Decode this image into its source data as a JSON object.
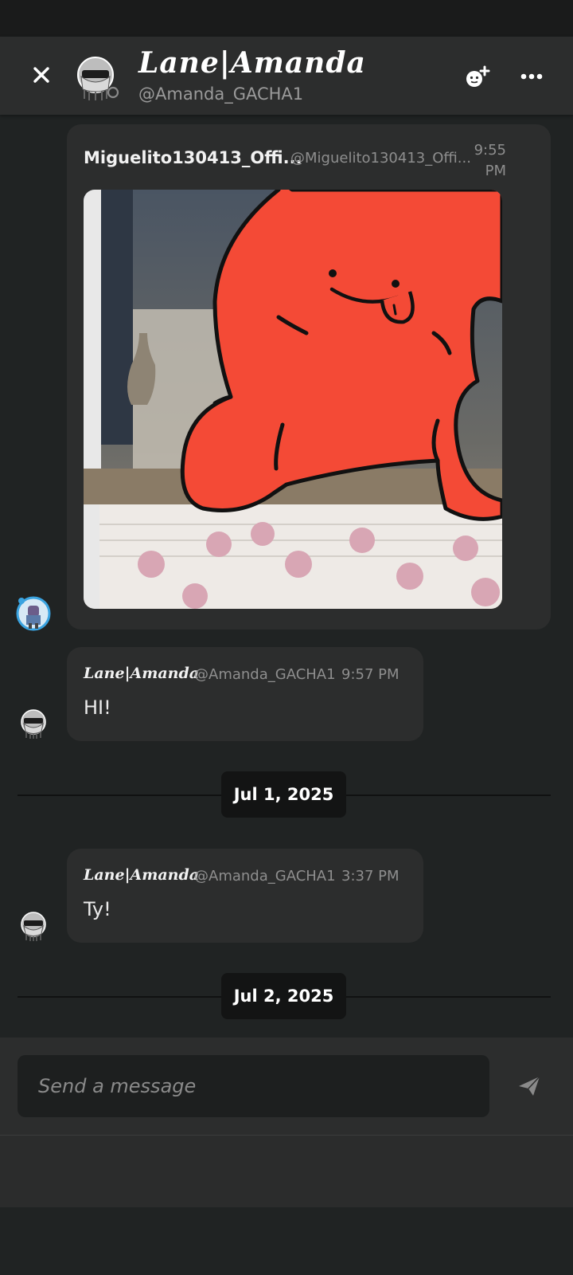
{
  "header": {
    "title": "Lane|Amanda",
    "handle": "@Amanda_GACHA1",
    "close_icon": "close-icon",
    "add_friend_icon": "add-friend-icon",
    "more_icon": "more-horizontal-icon"
  },
  "messages": [
    {
      "name": "Miguelito130413_Offi...",
      "handle": "@Miguelito130413_Offi...",
      "time": "9:55 PM",
      "attachment": "gif-image"
    },
    {
      "name": "Lane|Amanda",
      "handle": "@Amanda_GACHA1",
      "time": "9:57 PM",
      "text": "HI!"
    },
    {
      "name": "Lane|Amanda",
      "handle": "@Amanda_GACHA1",
      "time": "3:37 PM",
      "text": "Ty!"
    }
  ],
  "date_separators": [
    "Jul 1, 2025",
    "Jul 2, 2025"
  ],
  "composer": {
    "placeholder": "Send a message",
    "send_icon": "send-icon"
  },
  "colors": {
    "background": "#202323",
    "surface": "#2c2d2d",
    "pill": "#131414",
    "gif_character": "#f44a36"
  }
}
